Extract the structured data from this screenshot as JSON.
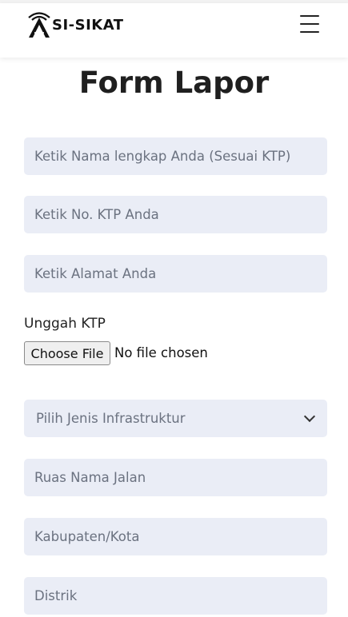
{
  "brand": {
    "name": "SI-SIKAT",
    "logo_icon": "tower-icon"
  },
  "nav": {
    "menu_icon": "hamburger-menu-icon"
  },
  "page": {
    "title": "Form Lapor"
  },
  "form": {
    "nama_placeholder": "Ketik Nama lengkap Anda (Sesuai KTP)",
    "ktp_placeholder": "Ketik No. KTP Anda",
    "alamat_placeholder": "Ketik Alamat Anda",
    "upload_label": "Unggah KTP",
    "file_button": "Choose File",
    "file_status": "No file chosen",
    "infrastruktur_select": "Pilih Jenis Infrastruktur",
    "ruas_placeholder": "Ruas Nama Jalan",
    "kabupaten_placeholder": "Kabupaten/Kota",
    "distrik_placeholder": "Distrik"
  },
  "colors": {
    "field_bg": "#eaedf6",
    "placeholder": "#6b7280",
    "title": "#1f1f1f"
  }
}
